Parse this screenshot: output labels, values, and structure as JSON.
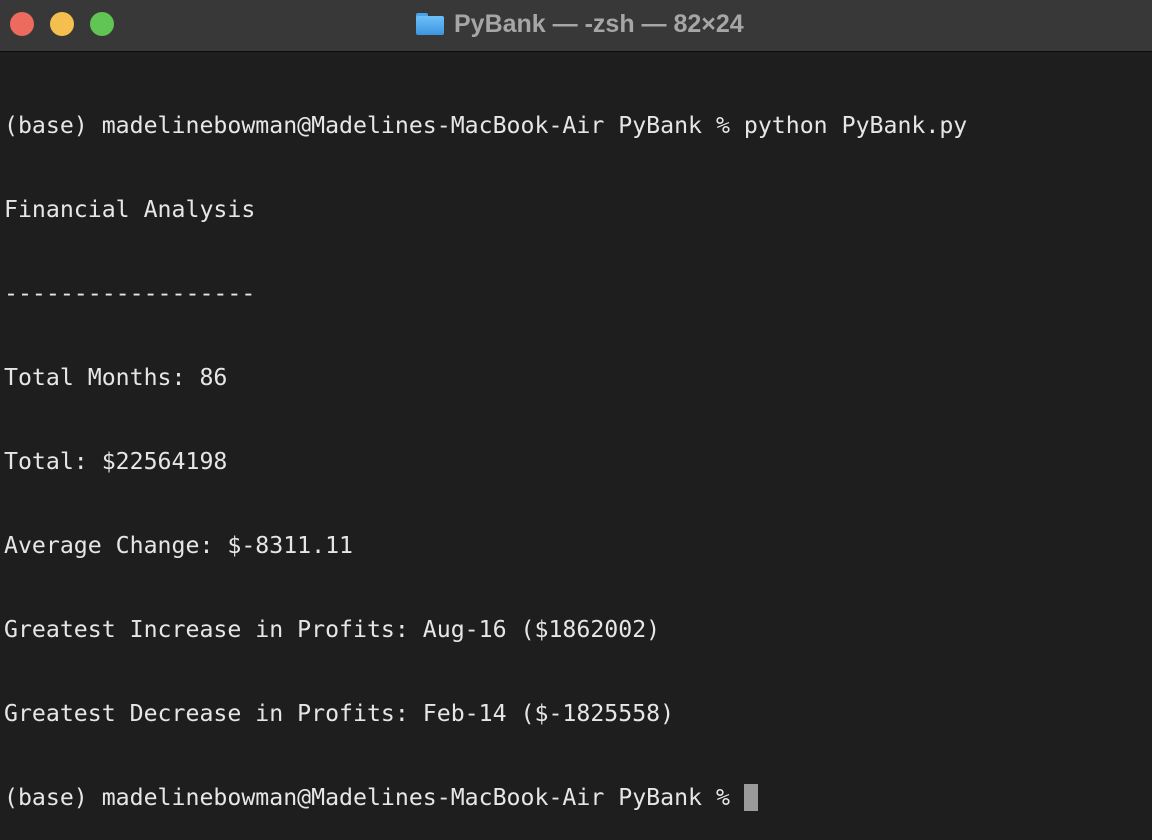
{
  "window": {
    "title": "PyBank — -zsh — 82×24",
    "title_icon": "folder-icon",
    "traffic_lights": {
      "close": "#ed6a5e",
      "minimize": "#f5bf4f",
      "zoom": "#61c554"
    }
  },
  "terminal": {
    "lines": [
      "(base) madelinebowman@Madelines-MacBook-Air PyBank % python PyBank.py",
      "Financial Analysis",
      "------------------",
      "Total Months: 86",
      "Total: $22564198",
      "Average Change: $-8311.11",
      "Greatest Increase in Profits: Aug-16 ($1862002)",
      "Greatest Decrease in Profits: Feb-14 ($-1825558)"
    ],
    "prompt": "(base) madelinebowman@Madelines-MacBook-Air PyBank % "
  }
}
